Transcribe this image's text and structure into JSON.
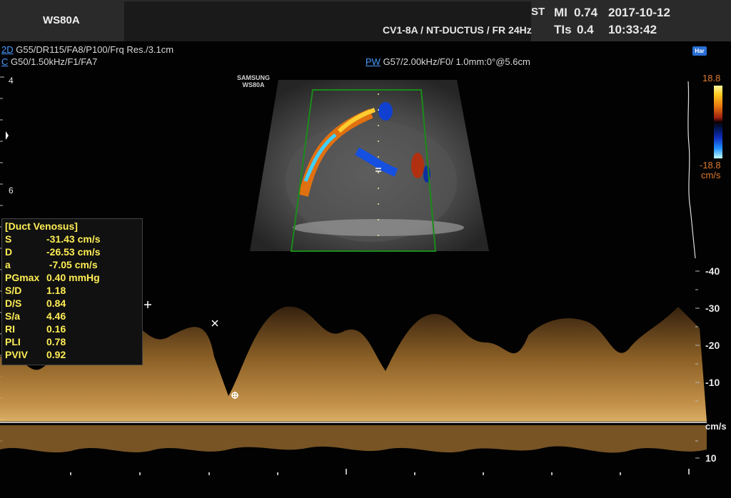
{
  "header": {
    "model": "WS80A",
    "st_fragment": "ST",
    "mi_label": "MI",
    "mi_value": "0.74",
    "tis_label": "TIs",
    "tis_value": "0.4",
    "date": "2017-10-12",
    "time": "10:33:42",
    "probe_preset": "CV1-8A / NT-DUCTUS / FR 24Hz"
  },
  "params": {
    "twod_tag": "2D",
    "twod_text": " G55/DR115/FA8/P100/Frq Res./3.1cm",
    "color_tag": "C",
    "color_text": " G50/1.50kHz/F1/FA7",
    "pw_tag": "PW",
    "pw_text": " G57/2.00kHz/F0/ 1.0mm:0°@5.6cm"
  },
  "har_badge": "Har",
  "logo": {
    "line1": "SAMSUNG",
    "line2": "WS80A"
  },
  "color_scale": {
    "top": "18.8",
    "bottom": "-18.8",
    "unit": "cm/s"
  },
  "depth_scale": {
    "top": "4",
    "mid": "6"
  },
  "measurements": {
    "title": "[Duct Venosus]",
    "rows": [
      {
        "k": "S",
        "v": "-31.43 cm/s"
      },
      {
        "k": "D",
        "v": "-26.53 cm/s"
      },
      {
        "k": "a",
        "v": " -7.05 cm/s"
      },
      {
        "k": "PGmax",
        "v": "0.40 mmHg"
      },
      {
        "k": "S/D",
        "v": "1.18"
      },
      {
        "k": "D/S",
        "v": "0.84"
      },
      {
        "k": "S/a",
        "v": "4.46"
      },
      {
        "k": "RI",
        "v": "0.16"
      },
      {
        "k": "PLI",
        "v": "0.78"
      },
      {
        "k": "PVIV",
        "v": "0.92"
      }
    ]
  },
  "velocity_scale": {
    "labels": [
      "-40",
      "-30",
      "-20",
      "-10",
      "10"
    ],
    "unit": "cm/s"
  },
  "colors": {
    "doppler": "#c8903a",
    "yellow_text": "#ffee55",
    "link_blue": "#4a9bff"
  }
}
